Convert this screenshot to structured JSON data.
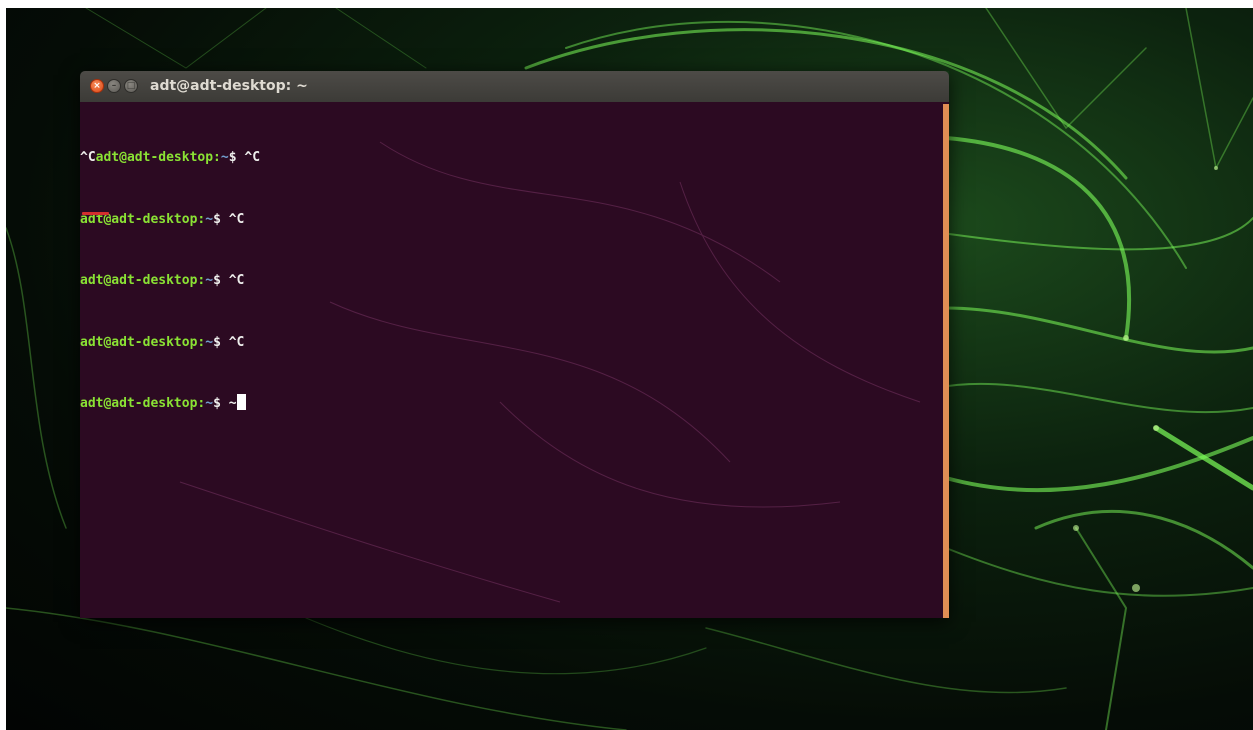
{
  "window": {
    "title": "adt@adt-desktop: ~",
    "close_glyph": "×",
    "minimize_glyph": "–",
    "maximize_glyph": "□"
  },
  "terminal": {
    "line1": {
      "prefix": "^C",
      "prompt": "adt@adt-desktop:",
      "tilde": "~",
      "dollar": "$ ",
      "input": "^C"
    },
    "line2": {
      "prompt": "adt@adt-desktop:",
      "tilde": "~",
      "dollar": "$ ",
      "input": "^C"
    },
    "line3": {
      "prompt": "adt@adt-desktop:",
      "tilde": "~",
      "dollar": "$ ",
      "input": "^C"
    },
    "line4": {
      "prompt": "adt@adt-desktop:",
      "tilde": "~",
      "dollar": "$ ",
      "input": "^C"
    },
    "line5": {
      "prompt": "adt@adt-desktop:",
      "tilde": "~",
      "dollar": "$ ",
      "input": "~"
    }
  },
  "colors": {
    "terminal_background": "#2c0a22",
    "prompt_green": "#8ae234",
    "path_blue": "#729fcf",
    "scrollbar_orange": "#e08e54",
    "annotation_red": "#d42e2e"
  }
}
